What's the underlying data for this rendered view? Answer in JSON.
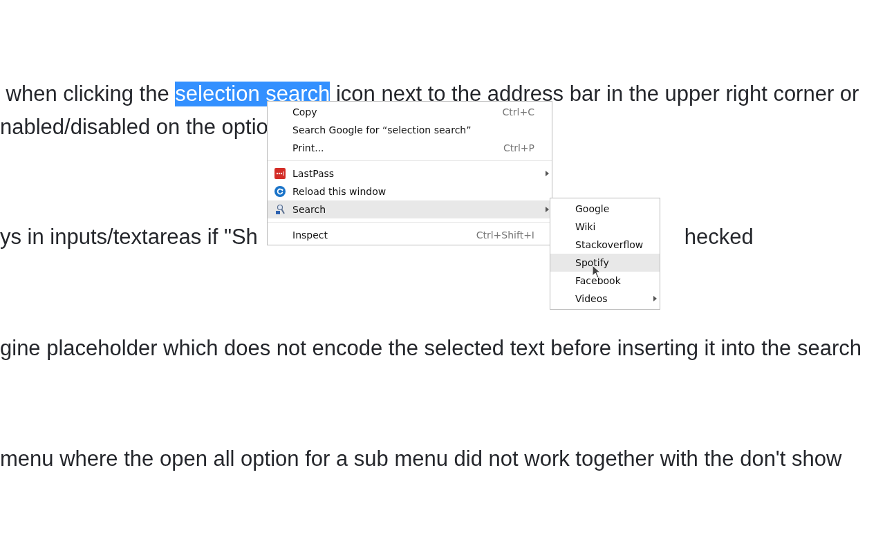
{
  "page_text": {
    "lines": [
      {
        "segments": [
          {
            "kind": "plain",
            "text": " when clicking the "
          },
          {
            "kind": "highlight",
            "text": "selection search"
          },
          {
            "kind": "plain",
            "text": " icon next to the address bar in the upper right corner or"
          }
        ]
      },
      {
        "segments": [
          {
            "kind": "plain",
            "text": "nabled/disabled on the optio"
          }
        ]
      },
      {
        "segments": [
          {
            "kind": "plain",
            "text": "ys in inputs/textareas if \"Sh"
          },
          {
            "kind": "beyond_menu",
            "text": "hecked"
          }
        ]
      },
      {
        "segments": [
          {
            "kind": "plain",
            "text": "gine placeholder which does not encode the selected text before inserting it into the search"
          }
        ]
      },
      {
        "segments": [
          {
            "kind": "plain",
            "text": "menu where the open all option for a sub menu did not work together with the don't show"
          }
        ]
      }
    ]
  },
  "context_menu": {
    "items": [
      {
        "kind": "command",
        "label": "Copy",
        "shortcut": "Ctrl+C",
        "has_submenu": false,
        "selected": false
      },
      {
        "kind": "command",
        "label": "Search Google for “selection search”",
        "has_submenu": false,
        "selected": false
      },
      {
        "kind": "command",
        "label": "Print...",
        "shortcut": "Ctrl+P",
        "has_submenu": false,
        "selected": false
      },
      {
        "kind": "separator"
      },
      {
        "kind": "extension",
        "label": "LastPass",
        "has_submenu": true,
        "selected": false
      },
      {
        "kind": "reload",
        "label": "Reload this window",
        "has_submenu": false,
        "selected": false
      },
      {
        "kind": "lookup",
        "label": "Search",
        "has_submenu": true,
        "selected": true
      },
      {
        "kind": "separator"
      },
      {
        "kind": "command",
        "label": "Inspect",
        "shortcut": "Ctrl+Shift+I",
        "has_submenu": false,
        "selected": false
      }
    ]
  },
  "submenu": {
    "items": [
      {
        "label": "Google",
        "has_submenu": false,
        "selected": false
      },
      {
        "label": "Wiki",
        "has_submenu": false,
        "selected": false
      },
      {
        "label": "Stackoverflow",
        "has_submenu": false,
        "selected": false
      },
      {
        "label": "Spotify",
        "has_submenu": false,
        "selected": true
      },
      {
        "label": "Facebook",
        "has_submenu": false,
        "selected": false
      },
      {
        "label": "Videos",
        "has_submenu": true,
        "selected": false
      }
    ]
  }
}
